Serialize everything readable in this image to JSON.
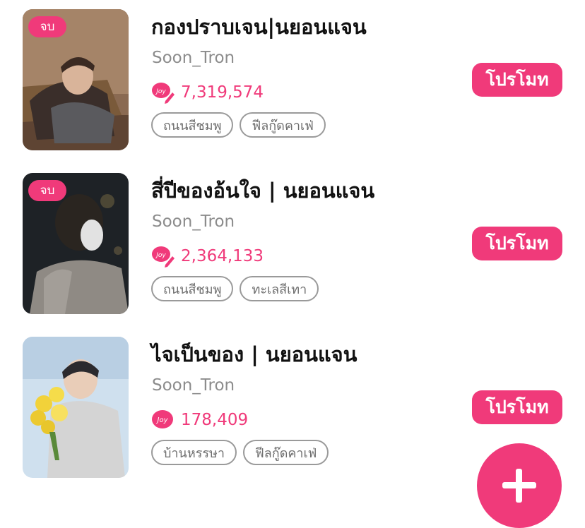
{
  "colors": {
    "accent": "#f03a7a",
    "muted": "#8c8c8c"
  },
  "stories": [
    {
      "completed_badge": "จบ",
      "title": "กองปราบเจน|นยอนแจน",
      "author": "Soon_Tron",
      "reads_icon": "joy-pen-icon",
      "reads": "7,319,574",
      "tags": [
        "ถนนสีชมพู",
        "ฟีลกู๊ดคาเฟ่"
      ],
      "promote_label": "โปรโมท"
    },
    {
      "completed_badge": "จบ",
      "title": "สี่ปีของอ้นใจ | นยอนแจน",
      "author": "Soon_Tron",
      "reads_icon": "joy-pen-icon",
      "reads": "2,364,133",
      "tags": [
        "ถนนสีชมพู",
        "ทะเลสีเทา"
      ],
      "promote_label": "โปรโมท"
    },
    {
      "completed_badge": "",
      "title": "ไจเป็นของ | นยอนแจน",
      "author": "Soon_Tron",
      "reads_icon": "joy-icon",
      "reads": "178,409",
      "tags": [
        "บ้านหรรษา",
        "ฟีลกู๊ดคาเฟ่"
      ],
      "promote_label": "โปรโมท"
    }
  ],
  "fab_icon": "plus-icon"
}
